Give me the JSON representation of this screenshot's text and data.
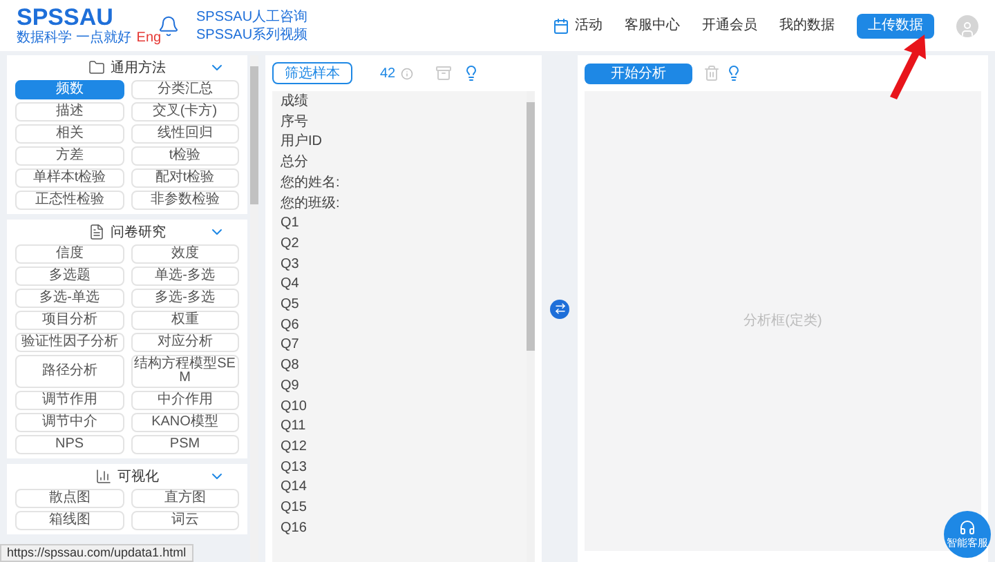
{
  "header": {
    "logo": {
      "title": "SPSSAU",
      "tagline": "数据科学 一点就好",
      "language": "Eng"
    },
    "links": [
      "SPSSAU人工咨询",
      "SPSSAU系列视频"
    ],
    "nav": [
      {
        "label": "活动",
        "kind": "icon-link"
      },
      {
        "label": "客服中心",
        "kind": "link"
      },
      {
        "label": "开通会员",
        "kind": "link"
      },
      {
        "label": "我的数据",
        "kind": "link"
      },
      {
        "label": "上传数据",
        "kind": "button"
      }
    ]
  },
  "sidebar": {
    "sections": [
      {
        "title": "通用方法",
        "expanded": true,
        "items": [
          {
            "label": "频数",
            "selected": true
          },
          {
            "label": "分类汇总",
            "selected": false
          },
          {
            "label": "描述",
            "selected": false
          },
          {
            "label": "交叉(卡方)",
            "selected": false
          },
          {
            "label": "相关",
            "selected": false
          },
          {
            "label": "线性回归",
            "selected": false
          },
          {
            "label": "方差",
            "selected": false
          },
          {
            "label": "t检验",
            "selected": false
          },
          {
            "label": "单样本t检验",
            "selected": false
          },
          {
            "label": "配对t检验",
            "selected": false
          },
          {
            "label": "正态性检验",
            "selected": false
          },
          {
            "label": "非参数检验",
            "selected": false
          }
        ]
      },
      {
        "title": "问卷研究",
        "expanded": true,
        "items": [
          {
            "label": "信度",
            "selected": false
          },
          {
            "label": "效度",
            "selected": false
          },
          {
            "label": "多选题",
            "selected": false
          },
          {
            "label": "单选-多选",
            "selected": false
          },
          {
            "label": "多选-单选",
            "selected": false
          },
          {
            "label": "多选-多选",
            "selected": false
          },
          {
            "label": "项目分析",
            "selected": false
          },
          {
            "label": "权重",
            "selected": false
          },
          {
            "label": "验证性因子分析",
            "selected": false
          },
          {
            "label": "对应分析",
            "selected": false
          },
          {
            "label": "路径分析",
            "selected": false
          },
          {
            "label": "结构方程模型SEM",
            "selected": false
          },
          {
            "label": "调节作用",
            "selected": false
          },
          {
            "label": "中介作用",
            "selected": false
          },
          {
            "label": "调节中介",
            "selected": false
          },
          {
            "label": "KANO模型",
            "selected": false
          },
          {
            "label": "NPS",
            "selected": false
          },
          {
            "label": "PSM",
            "selected": false
          }
        ]
      },
      {
        "title": "可视化",
        "expanded": true,
        "items": [
          {
            "label": "散点图",
            "selected": false
          },
          {
            "label": "直方图",
            "selected": false
          },
          {
            "label": "箱线图",
            "selected": false
          },
          {
            "label": "词云",
            "selected": false
          }
        ]
      }
    ]
  },
  "variables": {
    "filter_button": "筛选样本",
    "count": "42",
    "items": [
      "成绩",
      "序号",
      "用户ID",
      "总分",
      "您的姓名:",
      "您的班级:",
      "Q1",
      "Q2",
      "Q3",
      "Q4",
      "Q5",
      "Q6",
      "Q7",
      "Q8",
      "Q9",
      "Q10",
      "Q11",
      "Q12",
      "Q13",
      "Q14",
      "Q15",
      "Q16"
    ]
  },
  "analysis": {
    "start_button": "开始分析",
    "placeholder": "分析框(定类)"
  },
  "status_url": "https://spssau.com/updata1.html",
  "chat_label": "智能客服"
}
